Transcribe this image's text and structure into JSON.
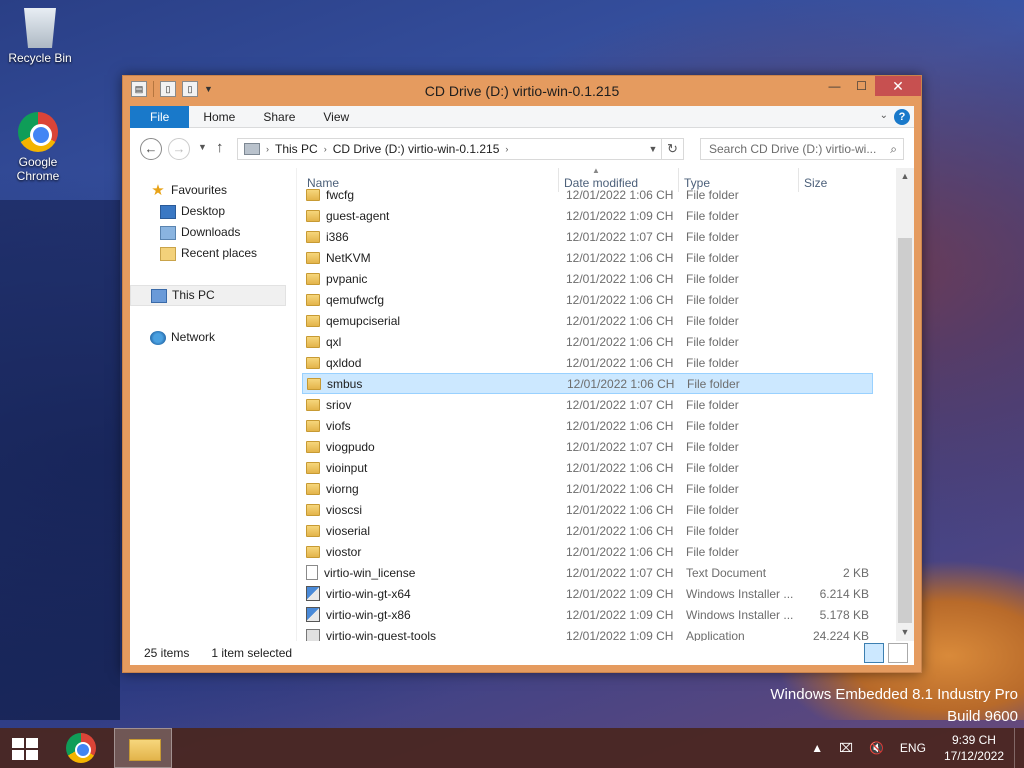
{
  "desktop": {
    "icons": [
      {
        "label": "Recycle Bin",
        "icon": "recycle-bin-icon"
      },
      {
        "label": "Google Chrome",
        "icon": "chrome-icon"
      }
    ],
    "watermark_line1": "Windows Embedded 8.1 Industry Pro",
    "watermark_line2": "Build 9600"
  },
  "window": {
    "title": "CD Drive (D:) virtio-win-0.1.215",
    "accent": "#e59b5f",
    "ribbon_tabs": [
      "File",
      "Home",
      "Share",
      "View"
    ],
    "address": {
      "crumb1": "This PC",
      "crumb2": "CD Drive (D:) virtio-win-0.1.215"
    },
    "search_placeholder": "Search CD Drive (D:) virtio-wi..."
  },
  "nav": {
    "favourites": "Favourites",
    "desktop": "Desktop",
    "downloads": "Downloads",
    "recent": "Recent places",
    "this_pc": "This PC",
    "network": "Network"
  },
  "columns": {
    "name": "Name",
    "date": "Date modified",
    "type": "Type",
    "size": "Size"
  },
  "files": [
    {
      "name": "fwcfg",
      "date": "12/01/2022 1:06 CH",
      "type": "File folder",
      "size": "",
      "icon": "folder"
    },
    {
      "name": "guest-agent",
      "date": "12/01/2022 1:09 CH",
      "type": "File folder",
      "size": "",
      "icon": "folder"
    },
    {
      "name": "i386",
      "date": "12/01/2022 1:07 CH",
      "type": "File folder",
      "size": "",
      "icon": "folder"
    },
    {
      "name": "NetKVM",
      "date": "12/01/2022 1:06 CH",
      "type": "File folder",
      "size": "",
      "icon": "folder"
    },
    {
      "name": "pvpanic",
      "date": "12/01/2022 1:06 CH",
      "type": "File folder",
      "size": "",
      "icon": "folder"
    },
    {
      "name": "qemufwcfg",
      "date": "12/01/2022 1:06 CH",
      "type": "File folder",
      "size": "",
      "icon": "folder"
    },
    {
      "name": "qemupciserial",
      "date": "12/01/2022 1:06 CH",
      "type": "File folder",
      "size": "",
      "icon": "folder"
    },
    {
      "name": "qxl",
      "date": "12/01/2022 1:06 CH",
      "type": "File folder",
      "size": "",
      "icon": "folder"
    },
    {
      "name": "qxldod",
      "date": "12/01/2022 1:06 CH",
      "type": "File folder",
      "size": "",
      "icon": "folder"
    },
    {
      "name": "smbus",
      "date": "12/01/2022 1:06 CH",
      "type": "File folder",
      "size": "",
      "icon": "folder",
      "selected": true
    },
    {
      "name": "sriov",
      "date": "12/01/2022 1:07 CH",
      "type": "File folder",
      "size": "",
      "icon": "folder"
    },
    {
      "name": "viofs",
      "date": "12/01/2022 1:06 CH",
      "type": "File folder",
      "size": "",
      "icon": "folder"
    },
    {
      "name": "viogpudo",
      "date": "12/01/2022 1:07 CH",
      "type": "File folder",
      "size": "",
      "icon": "folder"
    },
    {
      "name": "vioinput",
      "date": "12/01/2022 1:06 CH",
      "type": "File folder",
      "size": "",
      "icon": "folder"
    },
    {
      "name": "viorng",
      "date": "12/01/2022 1:06 CH",
      "type": "File folder",
      "size": "",
      "icon": "folder"
    },
    {
      "name": "vioscsi",
      "date": "12/01/2022 1:06 CH",
      "type": "File folder",
      "size": "",
      "icon": "folder"
    },
    {
      "name": "vioserial",
      "date": "12/01/2022 1:06 CH",
      "type": "File folder",
      "size": "",
      "icon": "folder"
    },
    {
      "name": "viostor",
      "date": "12/01/2022 1:06 CH",
      "type": "File folder",
      "size": "",
      "icon": "folder"
    },
    {
      "name": "virtio-win_license",
      "date": "12/01/2022 1:07 CH",
      "type": "Text Document",
      "size": "2 KB",
      "icon": "doc"
    },
    {
      "name": "virtio-win-gt-x64",
      "date": "12/01/2022 1:09 CH",
      "type": "Windows Installer ...",
      "size": "6.214 KB",
      "icon": "msi"
    },
    {
      "name": "virtio-win-gt-x86",
      "date": "12/01/2022 1:09 CH",
      "type": "Windows Installer ...",
      "size": "5.178 KB",
      "icon": "msi"
    },
    {
      "name": "virtio-win-guest-tools",
      "date": "12/01/2022 1:09 CH",
      "type": "Application",
      "size": "24.224 KB",
      "icon": "app"
    }
  ],
  "status": {
    "items": "25 items",
    "selected": "1 item selected"
  },
  "taskbar": {
    "lang": "ENG",
    "time": "9:39 CH",
    "date": "17/12/2022"
  }
}
